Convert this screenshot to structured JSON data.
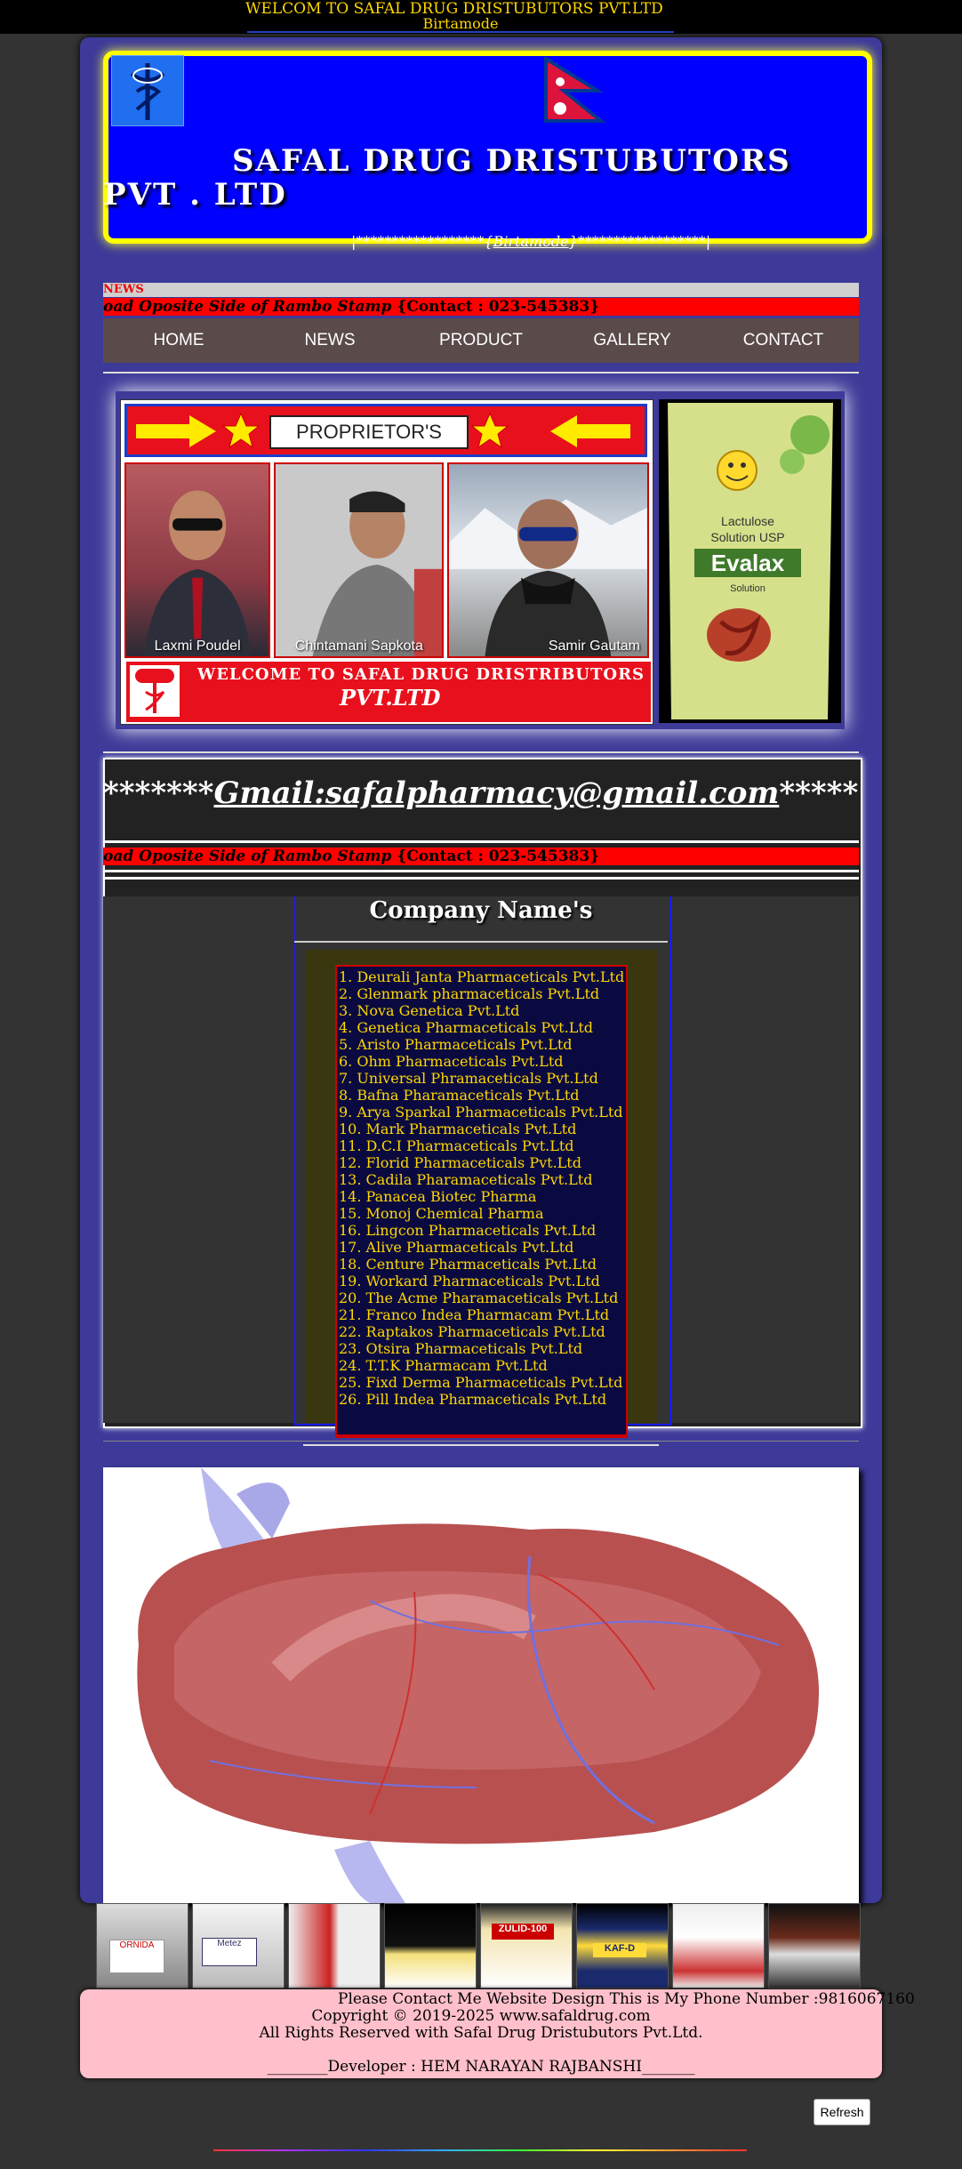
{
  "topbar": {
    "welcome": "WELCOM TO SAFAL DRUG DRISTUBUTORS PVT.LTD",
    "location": "Birtamode"
  },
  "header": {
    "title_line1": "SAFAL DRUG DRISTUBUTORS",
    "title_line2": "PVT . LTD",
    "sub_banner_left": "|******************{",
    "sub_banner_link": "Birtamode",
    "sub_banner_right": "}******************|"
  },
  "news": {
    "label": "NEWS",
    "ticker_address": "oad Oposite Side of Rambo Stamp",
    "ticker_contact": "{Contact : 023-545383}"
  },
  "nav": {
    "items": [
      "HOME",
      "NEWS",
      "PRODUCT",
      "GALLERY",
      "CONTACT"
    ]
  },
  "proprietors": {
    "heading": "PROPRIETOR'S",
    "people": [
      "Laxmi Poudel",
      "Chintamani Sapkota",
      "Samir Gautam"
    ],
    "welcome_line1": "WELCOME TO SAFAL DRUG DRISTRIBUTORS",
    "welcome_line2": "PVT.LTD"
  },
  "product_image": {
    "text1": "Lactulose",
    "text2": "Solution USP",
    "brand": "Evalax",
    "text3": "Solution"
  },
  "contact": {
    "email_prefix": "*******",
    "email": "Gmail:safalpharmacy@gmail.com",
    "email_suffix": "********"
  },
  "companies": {
    "title": "Company Name's",
    "list": [
      "1. Deurali Janta Pharmaceticals Pvt.Ltd",
      "2.  Glenmark pharmaceticals Pvt.Ltd",
      " 3.  Nova Genetica Pvt.Ltd",
      "4. Genetica Pharmaceticals Pvt.Ltd",
      "5.  Aristo Pharmaceticals Pvt.Ltd",
      "6. Ohm Pharmaceticals Pvt.Ltd",
      "7. Universal Phramaceticals Pvt.Ltd",
      "8. Bafna Pharamaceticals Pvt.Ltd",
      "9. Arya Sparkal Pharmaceticals Pvt.Ltd",
      "10. Mark Pharmaceticals Pvt.Ltd",
      "11. D.C.I Pharmaceticals Pvt.Ltd",
      "12. Florid Pharmaceticals Pvt.Ltd",
      "13. Cadila Pharamaceticals Pvt.Ltd",
      "14. Panacea Biotec Pharma",
      "15. Monoj Chemical Pharma",
      "16. Lingcon Pharmaceticals Pvt.Ltd",
      "17. Alive Pharmaceticals Pvt.Ltd",
      "18. Centure Pharmaceticals Pvt.Ltd",
      "19. Workard Pharmaceticals Pvt.Ltd",
      "20. The Acme Pharamaceticals Pvt.Ltd",
      "21. Franco Indea Pharmacam Pvt.Ltd",
      "22. Raptakos Pharmaceticals Pvt.Ltd",
      "23. Otsira Pharmaceticals Pvt.Ltd",
      "24. T.T.K Pharmacam Pvt.Ltd",
      "25. Fixd Derma Pharmaceticals Pvt.Ltd",
      "26. Pill Indea Pharmaceticals Pvt.Ltd"
    ]
  },
  "thumbnails": {
    "labels": [
      "ORNIDA",
      "Metez",
      "",
      "",
      "ZULID-100",
      "KAF-D",
      "",
      ""
    ]
  },
  "footer": {
    "line1": "Please Contact Me Website Design This is My Phone Number :9816067160",
    "line2": "Copyright © 2019-2025 www.safaldrug.com",
    "line3": "All Rights Reserved with Safal Drug Dristubutors Pvt.Ltd.",
    "line4": "________Developer : HEM NARAYAN RAJBANSHI_______"
  },
  "refresh_label": "Refresh",
  "colors": {
    "header_blue": "#0000ff",
    "header_border": "#ffff00",
    "ticker_red": "#ff0000",
    "list_text": "#ffd700",
    "container": "#3d3a99",
    "footer_pink": "#ffc0cb"
  }
}
